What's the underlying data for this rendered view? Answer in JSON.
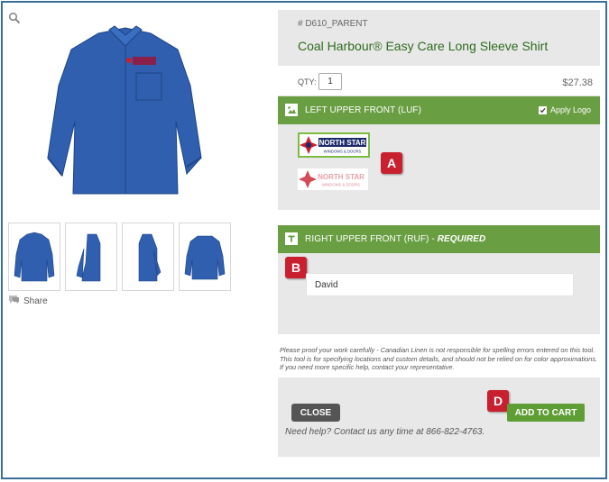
{
  "product": {
    "sku": "# D610_PARENT",
    "title": "Coal Harbour® Easy Care Long Sleeve Shirt",
    "qty_label": "QTY:",
    "qty_value": "1",
    "price": "$27.38"
  },
  "gallery": {
    "thumbnails": [
      "front-view",
      "side-view",
      "side-view-alt",
      "back-view"
    ],
    "share_label": "Share"
  },
  "luf": {
    "title": "LEFT UPPER FRONT (LUF)",
    "apply_label": "Apply Logo",
    "apply_checked": true,
    "logos": [
      {
        "line1": "NORTH STAR",
        "line2": "WINDOWS & DOORS",
        "selected": true
      },
      {
        "line1": "NORTH STAR",
        "line2": "WINDOWS & DOORS",
        "selected": false
      }
    ]
  },
  "ruf": {
    "title": "RIGHT UPPER FRONT (RUF) - ",
    "required": "REQUIRED",
    "name_value": "David"
  },
  "disclaimer": "Please proof your work carefully - Canadian Linen is not responsible for spelling errors entered on this tool. This tool is for specifying locations and custom details, and should not be relied on for color approximations. If you need more specific help, contact your representative.",
  "footer": {
    "close_label": "CLOSE",
    "cart_label": "ADD TO CART",
    "help": "Need help? Contact us any time at 866-822-4763."
  },
  "markers": {
    "a": "A",
    "b": "B",
    "d": "D"
  },
  "colors": {
    "section_green": "#6a9e42",
    "title_green": "#2f6b1e",
    "marker_red": "#c8202f",
    "shirt_blue": "#2f5fae",
    "frame_blue": "#3a6f9a"
  }
}
